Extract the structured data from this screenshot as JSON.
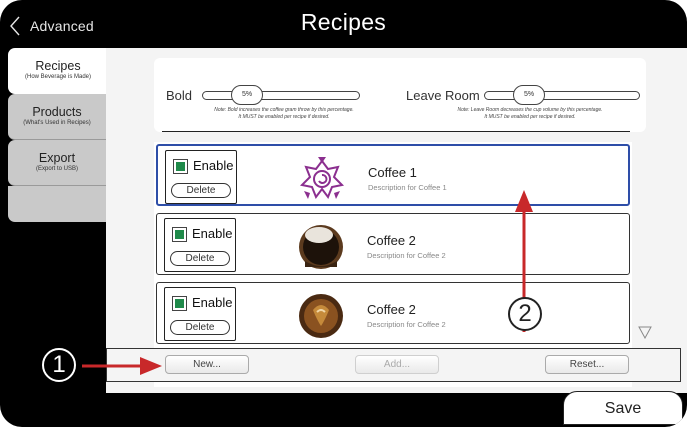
{
  "header": {
    "back_label": "Advanced",
    "title": "Recipes"
  },
  "sidebar": {
    "tabs": [
      {
        "label": "Recipes",
        "sub": "(How Beverage is Made)",
        "active": true
      },
      {
        "label": "Products",
        "sub": "(What's Used in Recipes)",
        "active": false
      },
      {
        "label": "Export",
        "sub": "(Export to USB)",
        "active": false
      }
    ]
  },
  "settings": {
    "bold": {
      "label": "Bold",
      "value": "5%",
      "note_line1": "Note: Bold increases the coffee gram throw by this percentage.",
      "note_line2": "It MUST be enabled per recipe if desired."
    },
    "leave_room": {
      "label": "Leave Room",
      "value": "5%",
      "note_line1": "Note: Leave Room decreases the cup volume by this percentage.",
      "note_line2": "It MUST be enabled per recipe if desired."
    }
  },
  "recipes": [
    {
      "enable_label": "Enable",
      "delete_label": "Delete",
      "name": "Coffee 1",
      "description": "Description for Coffee 1",
      "enabled": true,
      "selected": true,
      "icon": "mandala-logo-icon"
    },
    {
      "enable_label": "Enable",
      "delete_label": "Delete",
      "name": "Coffee 2",
      "description": "Description for Coffee 2",
      "enabled": true,
      "selected": false,
      "icon": "coffee-cup-photo-icon"
    },
    {
      "enable_label": "Enable",
      "delete_label": "Delete",
      "name": "Coffee 2",
      "description": "Description for Coffee 2",
      "enabled": true,
      "selected": false,
      "icon": "latte-photo-icon"
    }
  ],
  "actions": {
    "new_label": "New...",
    "add_label": "Add...",
    "reset_label": "Reset..."
  },
  "save_label": "Save",
  "callouts": {
    "one": "1",
    "two": "2"
  },
  "colors": {
    "accent_red": "#c8282a",
    "enabled_green": "#1f8a4a",
    "selection_blue": "#2e4ea8",
    "logo_purple": "#8b2f8f"
  }
}
